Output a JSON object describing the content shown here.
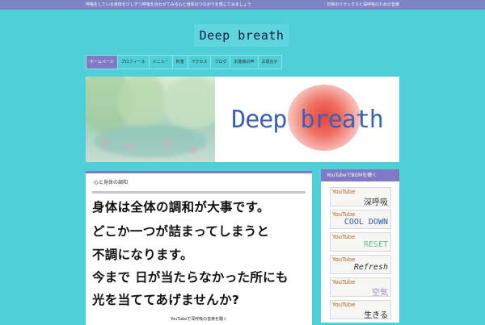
{
  "topbar": {
    "left_text": "呼吸をしている身体を少しずつ呼吸を合わせてみる心と身体のつながりを感じてみましょう",
    "right_text": "日常のリラックスと深呼吸のための音楽"
  },
  "site": {
    "logo": "Deep breath"
  },
  "nav": {
    "items": [
      {
        "label": "ホームページ"
      },
      {
        "label": "プロフィール"
      },
      {
        "label": "メニュー"
      },
      {
        "label": "料金"
      },
      {
        "label": "アクセス"
      },
      {
        "label": "ブログ"
      },
      {
        "label": "お客様の声"
      },
      {
        "label": "お問合せ"
      }
    ]
  },
  "hero": {
    "title": "Deep breath"
  },
  "main": {
    "heading": "心と身体の調和",
    "lines": [
      "身体は全体の調和が大事です。",
      "どこか一つが詰まってしまうと",
      "不調になります。",
      "今まで 日が当たらなかった所にも",
      "光を当ててあげませんか?"
    ],
    "caption": "YouTubeで深呼吸の音楽を聴く"
  },
  "sidebar": {
    "title": "YouTubeでBGMを聴く",
    "buttons": [
      {
        "yt": "YouTube",
        "label": "深呼吸",
        "color": "#333333"
      },
      {
        "yt": "YouTube",
        "label": "COOL DOWN",
        "color": "#2f54b0"
      },
      {
        "yt": "YouTube",
        "label": "RESET",
        "color": "#6dbf7a"
      },
      {
        "yt": "YouTube",
        "label": "Refresh",
        "color": "#2f2f2f"
      },
      {
        "yt": "YouTube",
        "label": "空気",
        "color": "#9b86c9"
      },
      {
        "yt": "YouTube",
        "label": "生きる",
        "color": "#222222"
      }
    ]
  },
  "colors": {
    "background": "#4fd0d9",
    "accent": "#8079c4",
    "hero_title": "#3d5fb8"
  }
}
